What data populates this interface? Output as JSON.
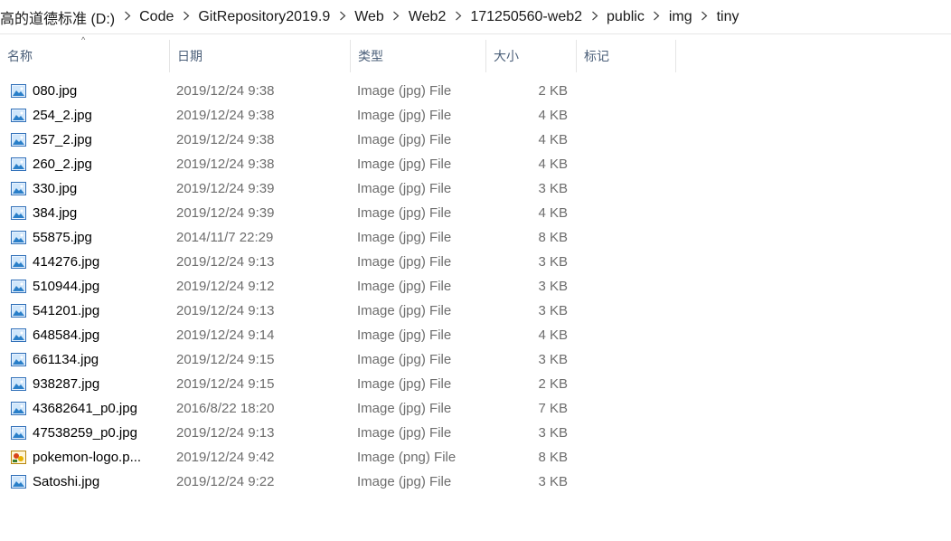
{
  "breadcrumb": {
    "items": [
      "高的道德标准 (D:)",
      "Code",
      "GitRepository2019.9",
      "Web",
      "Web2",
      "171250560-web2",
      "public",
      "img",
      "tiny"
    ],
    "separator_icon": "chevron-right-icon"
  },
  "columns": {
    "name": "名称",
    "date": "日期",
    "type": "类型",
    "size": "大小",
    "tags": "标记",
    "sort_indicator": "^"
  },
  "files": [
    {
      "name": "080.jpg",
      "date": "2019/12/24 9:38",
      "type": "Image (jpg) File",
      "size": "2 KB",
      "icon": "jpg-image-icon"
    },
    {
      "name": "254_2.jpg",
      "date": "2019/12/24 9:38",
      "type": "Image (jpg) File",
      "size": "4 KB",
      "icon": "jpg-image-icon"
    },
    {
      "name": "257_2.jpg",
      "date": "2019/12/24 9:38",
      "type": "Image (jpg) File",
      "size": "4 KB",
      "icon": "jpg-image-icon"
    },
    {
      "name": "260_2.jpg",
      "date": "2019/12/24 9:38",
      "type": "Image (jpg) File",
      "size": "4 KB",
      "icon": "jpg-image-icon"
    },
    {
      "name": "330.jpg",
      "date": "2019/12/24 9:39",
      "type": "Image (jpg) File",
      "size": "3 KB",
      "icon": "jpg-image-icon"
    },
    {
      "name": "384.jpg",
      "date": "2019/12/24 9:39",
      "type": "Image (jpg) File",
      "size": "4 KB",
      "icon": "jpg-image-icon"
    },
    {
      "name": "55875.jpg",
      "date": "2014/11/7 22:29",
      "type": "Image (jpg) File",
      "size": "8 KB",
      "icon": "jpg-image-icon"
    },
    {
      "name": "414276.jpg",
      "date": "2019/12/24 9:13",
      "type": "Image (jpg) File",
      "size": "3 KB",
      "icon": "jpg-image-icon"
    },
    {
      "name": "510944.jpg",
      "date": "2019/12/24 9:12",
      "type": "Image (jpg) File",
      "size": "3 KB",
      "icon": "jpg-image-icon"
    },
    {
      "name": "541201.jpg",
      "date": "2019/12/24 9:13",
      "type": "Image (jpg) File",
      "size": "3 KB",
      "icon": "jpg-image-icon"
    },
    {
      "name": "648584.jpg",
      "date": "2019/12/24 9:14",
      "type": "Image (jpg) File",
      "size": "4 KB",
      "icon": "jpg-image-icon"
    },
    {
      "name": "661134.jpg",
      "date": "2019/12/24 9:15",
      "type": "Image (jpg) File",
      "size": "3 KB",
      "icon": "jpg-image-icon"
    },
    {
      "name": "938287.jpg",
      "date": "2019/12/24 9:15",
      "type": "Image (jpg) File",
      "size": "2 KB",
      "icon": "jpg-image-icon"
    },
    {
      "name": "43682641_p0.jpg",
      "date": "2016/8/22 18:20",
      "type": "Image (jpg) File",
      "size": "7 KB",
      "icon": "jpg-image-icon"
    },
    {
      "name": "47538259_p0.jpg",
      "date": "2019/12/24 9:13",
      "type": "Image (jpg) File",
      "size": "3 KB",
      "icon": "jpg-image-icon"
    },
    {
      "name": "pokemon-logo.p...",
      "date": "2019/12/24 9:42",
      "type": "Image (png) File",
      "size": "8 KB",
      "icon": "png-image-icon"
    },
    {
      "name": "Satoshi.jpg",
      "date": "2019/12/24 9:22",
      "type": "Image (jpg) File",
      "size": "3 KB",
      "icon": "jpg-image-icon"
    }
  ]
}
